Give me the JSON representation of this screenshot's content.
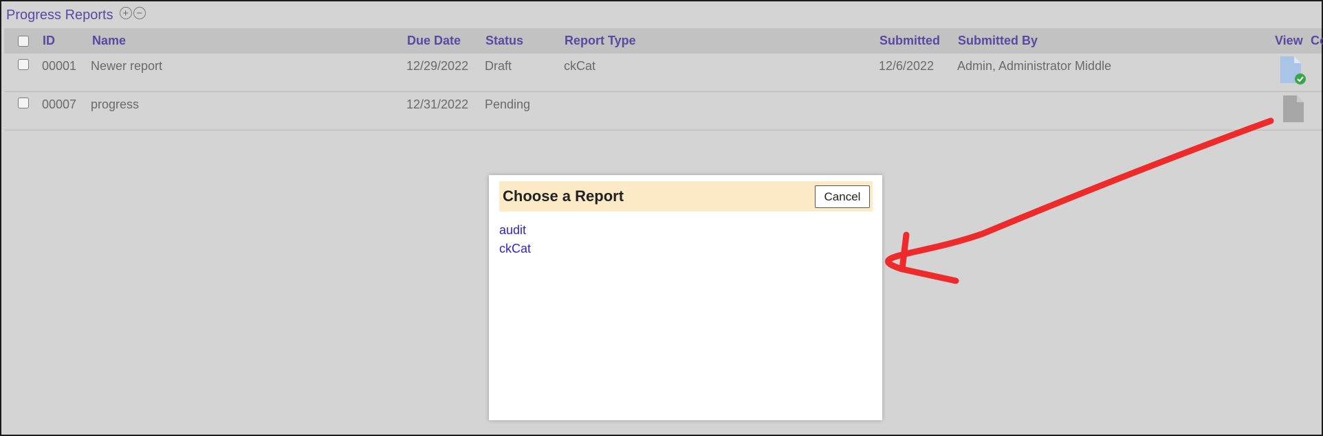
{
  "section": {
    "title": "Progress Reports",
    "expand_icon": "plus-circle-icon",
    "collapse_icon": "minus-circle-icon",
    "expand_glyph": "+",
    "collapse_glyph": "−"
  },
  "columns": {
    "id": "ID",
    "name": "Name",
    "due_date": "Due Date",
    "status": "Status",
    "report_type": "Report Type",
    "submitted": "Submitted",
    "submitted_by": "Submitted By",
    "view": "View",
    "cut_off": "Co"
  },
  "rows": [
    {
      "id": "00001",
      "name": "Newer report",
      "due_date": "12/29/2022",
      "status": "Draft",
      "report_type": "ckCat",
      "submitted": "12/6/2022",
      "submitted_by": "Admin, Administrator Middle",
      "view_icon": "document-check-icon"
    },
    {
      "id": "00007",
      "name": "progress",
      "due_date": "12/31/2022",
      "status": "Pending",
      "report_type": "",
      "submitted": "",
      "submitted_by": "",
      "view_icon": "document-icon"
    }
  ],
  "modal": {
    "title": "Choose a Report",
    "cancel_label": "Cancel",
    "reports": [
      "audit",
      "ckCat"
    ]
  },
  "colors": {
    "header_text": "#5a49a0",
    "link": "#2e24c8",
    "modal_header": "#fdebc8",
    "annotation": "#ee2a2a",
    "check_badge": "#3aa64a",
    "doc_blue": "#a9c4e6"
  }
}
